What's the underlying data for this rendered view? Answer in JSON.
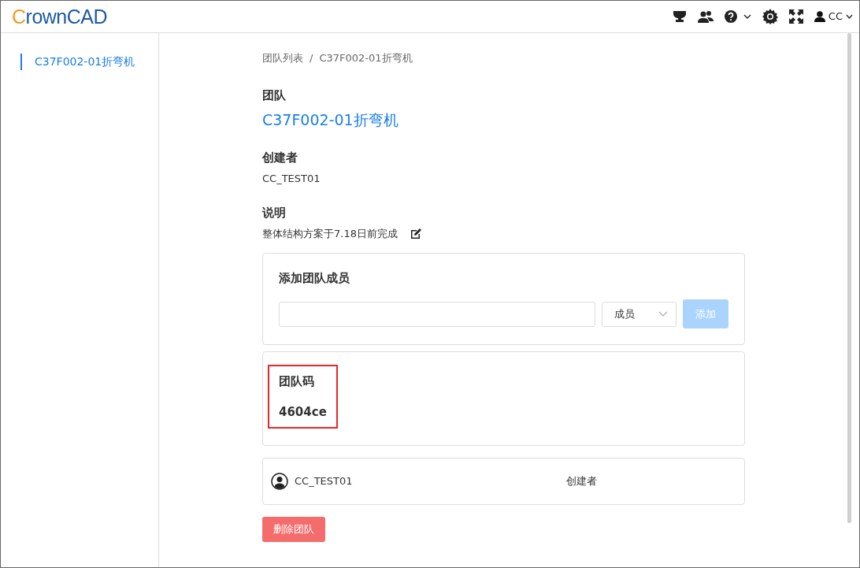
{
  "header": {
    "logo_first": "C",
    "logo_rest": "rownCAD",
    "user": "CC"
  },
  "sidebar": {
    "items": [
      {
        "label": "C37F002-01折弯机",
        "selected": true
      }
    ]
  },
  "breadcrumb": {
    "items": [
      "团队列表",
      "C37F002-01折弯机"
    ],
    "separator": "/"
  },
  "fields": [
    {
      "label": "团队",
      "value": "C37F002-01折弯机",
      "kind": "link"
    },
    {
      "label": "创建者",
      "value": "CC_TEST01",
      "kind": "text"
    },
    {
      "label": "说明",
      "value": "整体结构方案于7.18日前完成",
      "kind": "editable"
    }
  ],
  "add_member": {
    "title": "添加团队成员",
    "role": "成员",
    "button": {
      "label": "添加",
      "disabled": true
    }
  },
  "team_code": {
    "label": "团队码",
    "value": "4604ce",
    "highlighted": true
  },
  "members": [
    {
      "name": "CC_TEST01",
      "role": "创建者"
    }
  ],
  "delete_button": "删除团队"
}
